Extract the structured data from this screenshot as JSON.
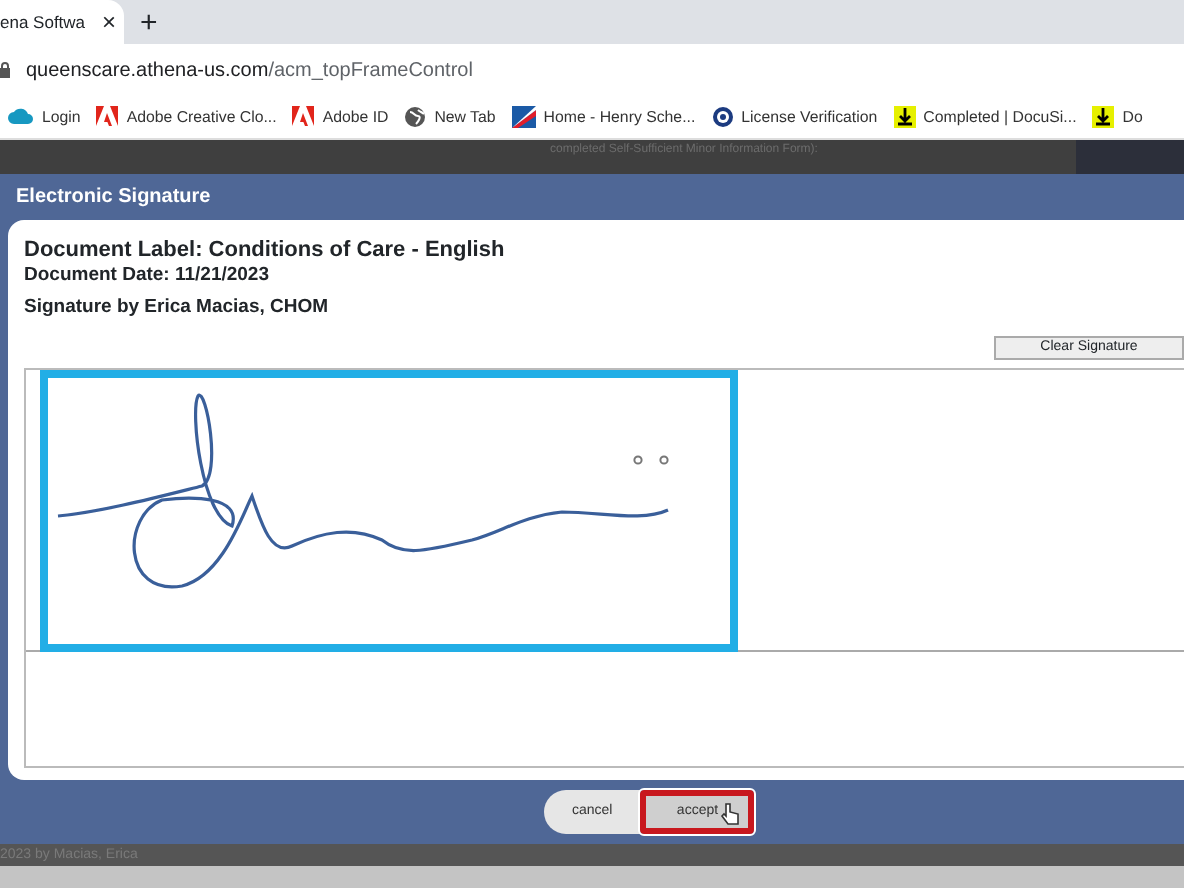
{
  "browser": {
    "tab": {
      "title": "ena Softwa",
      "close": "×"
    },
    "new_tab": "+",
    "address": {
      "host": "queenscare.athena-us.com",
      "path": "/acm_topFrameControl"
    },
    "bookmarks": [
      {
        "label": "Login",
        "kind": "cloud"
      },
      {
        "label": "Adobe Creative Clo...",
        "kind": "adobe"
      },
      {
        "label": "Adobe ID",
        "kind": "adobe"
      },
      {
        "label": "New Tab",
        "kind": "globe"
      },
      {
        "label": "Home - Henry Sche...",
        "kind": "flag"
      },
      {
        "label": "License Verification",
        "kind": "seal"
      },
      {
        "label": "Completed | DocuSi...",
        "kind": "download"
      },
      {
        "label": "Do",
        "kind": "download"
      }
    ]
  },
  "background_text": "completed Self-Sufficient Minor Information Form):",
  "dialog": {
    "title": "Electronic Signature",
    "document_label": "Document Label: Conditions of Care - English",
    "document_date": "Document Date: 11/21/2023",
    "signature_by": "Signature by Erica Macias, CHOM",
    "clear_button": "Clear Signature",
    "signature_pad": {
      "highlighted": true
    },
    "buttons": [
      {
        "label": "cancel",
        "highlighted": false
      },
      {
        "label": "accept",
        "highlighted": true
      }
    ]
  },
  "footer_text": "2023 by Macias, Erica"
}
